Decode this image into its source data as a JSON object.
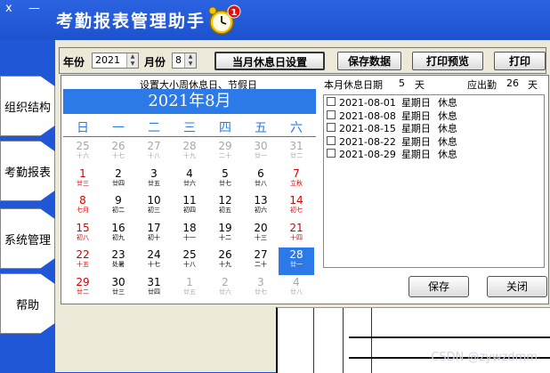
{
  "window": {
    "ctl_min": "x",
    "ctl_close": "—"
  },
  "app": {
    "title": "考勤报表管理助手",
    "badge": "1"
  },
  "sidebar": {
    "items": [
      {
        "label": "组织结构"
      },
      {
        "label": "考勤报表"
      },
      {
        "label": "系统管理"
      },
      {
        "label": "帮助"
      }
    ]
  },
  "toolbar": {
    "year_label": "年份",
    "year_value": "2021",
    "month_label": "月份",
    "month_value": "8",
    "btn_rest": "当月休息日设置",
    "btn_save": "保存数据",
    "btn_preview": "打印预览",
    "btn_print": "打印"
  },
  "panel": {
    "setting_title": "设置大小周休息日、节假日",
    "rest_label": "本月休息日期",
    "rest_count": "5",
    "rest_unit": "天",
    "attend_label": "应出勤",
    "attend_count": "26",
    "attend_unit": "天"
  },
  "calendar": {
    "title": "2021年8月",
    "weekdays": [
      "日",
      "一",
      "二",
      "三",
      "四",
      "五",
      "六"
    ],
    "days": [
      {
        "n": "25",
        "l": "十六",
        "t": "o"
      },
      {
        "n": "26",
        "l": "十七",
        "t": "o"
      },
      {
        "n": "27",
        "l": "十八",
        "t": "o"
      },
      {
        "n": "28",
        "l": "十九",
        "t": "o"
      },
      {
        "n": "29",
        "l": "二十",
        "t": "o"
      },
      {
        "n": "30",
        "l": "廿一",
        "t": "o"
      },
      {
        "n": "31",
        "l": "廿二",
        "t": "o"
      },
      {
        "n": "1",
        "l": "廿三",
        "t": "r"
      },
      {
        "n": "2",
        "l": "廿四",
        "t": "k"
      },
      {
        "n": "3",
        "l": "廿五",
        "t": "k"
      },
      {
        "n": "4",
        "l": "廿六",
        "t": "k"
      },
      {
        "n": "5",
        "l": "廿七",
        "t": "k"
      },
      {
        "n": "6",
        "l": "廿八",
        "t": "k"
      },
      {
        "n": "7",
        "l": "立秋",
        "t": "r"
      },
      {
        "n": "8",
        "l": "七月",
        "t": "r"
      },
      {
        "n": "9",
        "l": "初二",
        "t": "k"
      },
      {
        "n": "10",
        "l": "初三",
        "t": "k"
      },
      {
        "n": "11",
        "l": "初四",
        "t": "k"
      },
      {
        "n": "12",
        "l": "初五",
        "t": "k"
      },
      {
        "n": "13",
        "l": "初六",
        "t": "k"
      },
      {
        "n": "14",
        "l": "初七",
        "t": "r"
      },
      {
        "n": "15",
        "l": "初八",
        "t": "r"
      },
      {
        "n": "16",
        "l": "初九",
        "t": "k"
      },
      {
        "n": "17",
        "l": "初十",
        "t": "k"
      },
      {
        "n": "18",
        "l": "十一",
        "t": "k"
      },
      {
        "n": "19",
        "l": "十二",
        "t": "k"
      },
      {
        "n": "20",
        "l": "十三",
        "t": "k"
      },
      {
        "n": "21",
        "l": "十四",
        "t": "r"
      },
      {
        "n": "22",
        "l": "十五",
        "t": "r"
      },
      {
        "n": "23",
        "l": "处暑",
        "t": "k"
      },
      {
        "n": "24",
        "l": "十七",
        "t": "k"
      },
      {
        "n": "25",
        "l": "十八",
        "t": "k"
      },
      {
        "n": "26",
        "l": "十九",
        "t": "k"
      },
      {
        "n": "27",
        "l": "二十",
        "t": "k"
      },
      {
        "n": "28",
        "l": "廿一",
        "t": "s"
      },
      {
        "n": "29",
        "l": "廿二",
        "t": "r"
      },
      {
        "n": "30",
        "l": "廿三",
        "t": "k"
      },
      {
        "n": "31",
        "l": "廿四",
        "t": "k"
      },
      {
        "n": "1",
        "l": "廿五",
        "t": "o"
      },
      {
        "n": "2",
        "l": "廿六",
        "t": "o"
      },
      {
        "n": "3",
        "l": "廿七",
        "t": "o"
      },
      {
        "n": "4",
        "l": "廿八",
        "t": "o"
      }
    ]
  },
  "rest_list": [
    {
      "date": "2021-08-01",
      "weekday": "星期日",
      "status": "休息"
    },
    {
      "date": "2021-08-08",
      "weekday": "星期日",
      "status": "休息"
    },
    {
      "date": "2021-08-15",
      "weekday": "星期日",
      "status": "休息"
    },
    {
      "date": "2021-08-22",
      "weekday": "星期日",
      "status": "休息"
    },
    {
      "date": "2021-08-29",
      "weekday": "星期日",
      "status": "休息"
    }
  ],
  "actions": {
    "save": "保存",
    "close": "关闭"
  },
  "watermark": "CSDN @zywzdmm",
  "colors": {
    "accent": "#2b7ae8",
    "holiday": "#d40000",
    "other_month": "#a8a8a8",
    "selected_bg": "#2b7ae8"
  }
}
